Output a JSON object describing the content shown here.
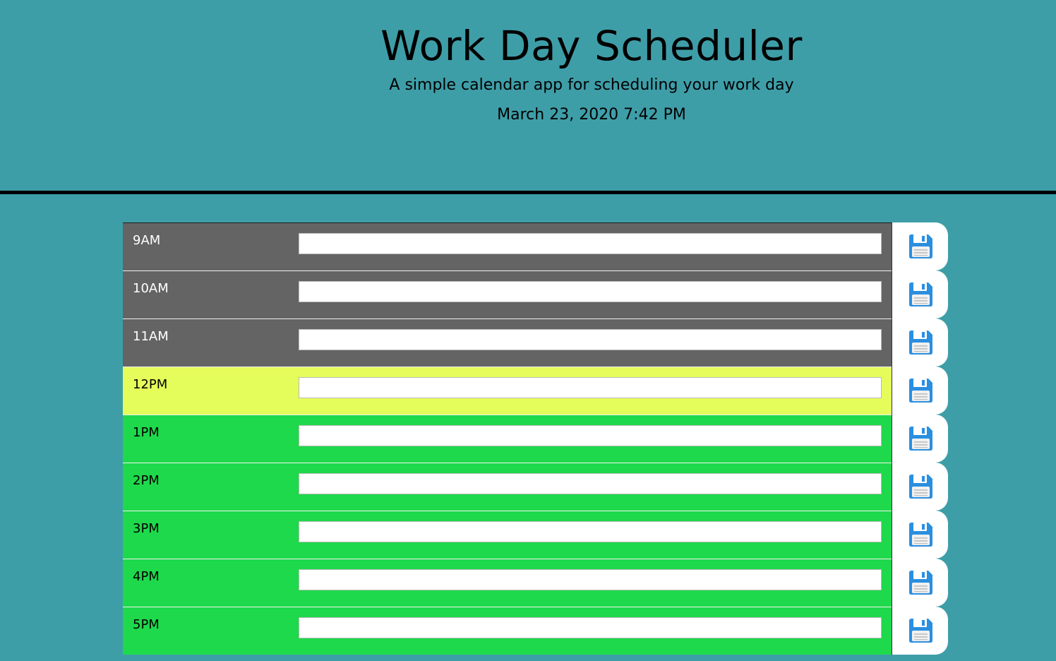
{
  "header": {
    "title": "Work Day Scheduler",
    "subtitle": "A simple calendar app for scheduling your work day",
    "datetime": "March 23, 2020 7:42 PM"
  },
  "colors": {
    "background": "#3e9ea8",
    "past": "#646464",
    "present": "#e5fd5a",
    "future": "#1ed94b",
    "save_icon": "#2b8fe0"
  },
  "timeblocks": [
    {
      "hour": "9AM",
      "state": "past",
      "value": "",
      "save_icon": "floppy-disk-icon"
    },
    {
      "hour": "10AM",
      "state": "past",
      "value": "",
      "save_icon": "floppy-disk-icon"
    },
    {
      "hour": "11AM",
      "state": "past",
      "value": "",
      "save_icon": "floppy-disk-icon"
    },
    {
      "hour": "12PM",
      "state": "present",
      "value": "",
      "save_icon": "floppy-disk-icon"
    },
    {
      "hour": "1PM",
      "state": "future",
      "value": "",
      "save_icon": "floppy-disk-icon"
    },
    {
      "hour": "2PM",
      "state": "future",
      "value": "",
      "save_icon": "floppy-disk-icon"
    },
    {
      "hour": "3PM",
      "state": "future",
      "value": "",
      "save_icon": "floppy-disk-icon"
    },
    {
      "hour": "4PM",
      "state": "future",
      "value": "",
      "save_icon": "floppy-disk-icon"
    },
    {
      "hour": "5PM",
      "state": "future",
      "value": "",
      "save_icon": "floppy-disk-icon"
    }
  ]
}
